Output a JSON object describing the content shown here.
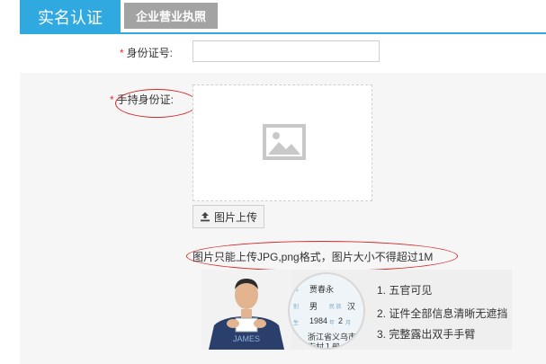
{
  "tabs": {
    "active_label": "实名认证",
    "inactive_label": "企业营业执照"
  },
  "form": {
    "required_mark": "*",
    "id_number_label": "身份证号:",
    "id_number_value": "",
    "handheld_id_label": "手持身份证:",
    "upload_button_label": "图片上传",
    "upload_hint": "图片只能上传JPG,png格式，图片大小不得超过1M"
  },
  "sample_card": {
    "name": "贾春永",
    "sex": "男",
    "ethnicity_label": "民 族",
    "ethnicity": "汉",
    "birth_year": "1984",
    "year_unit": "年",
    "birth_month": "2",
    "month_unit": "月",
    "address_line1": "浙江省义乌市",
    "address_line2": "街村１册",
    "shirt_text": "JAMES",
    "field_keys": [
      "名",
      "别",
      "生",
      "址"
    ]
  },
  "requirements": [
    "1. 五官可见",
    "2. 证件全部信息清晰无遮挡",
    "3. 完整露出双手手臂"
  ],
  "colors": {
    "accent": "#30a8e0",
    "inactive_tab": "#a3a3a3",
    "required": "#e33333",
    "annotation": "#d62828"
  }
}
